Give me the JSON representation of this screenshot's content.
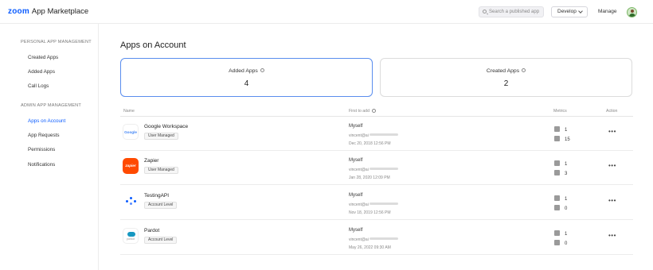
{
  "header": {
    "brand": "zoom",
    "app_name": "App Marketplace",
    "search_placeholder": "Search a published app",
    "develop_label": "Develop",
    "manage_label": "Manage",
    "icons": [
      "search-icon",
      "chevron-down-icon",
      "avatar"
    ]
  },
  "sidebar": {
    "personal_heading": "PERSONAL APP MANAGEMENT",
    "personal_items": [
      {
        "label": "Created Apps"
      },
      {
        "label": "Added Apps"
      },
      {
        "label": "Call Logs"
      }
    ],
    "admin_heading": "ADMIN APP MANAGEMENT",
    "admin_items": [
      {
        "label": "Apps on Account",
        "active": true
      },
      {
        "label": "App Requests"
      },
      {
        "label": "Permissions"
      },
      {
        "label": "Notifications"
      }
    ],
    "active_color": "#0b5cff"
  },
  "main": {
    "title": "Apps on Account",
    "cards": [
      {
        "label": "Added Apps",
        "value": "4",
        "selected": true
      },
      {
        "label": "Created Apps",
        "value": "2",
        "selected": false
      }
    ],
    "table": {
      "headers": {
        "name": "Name",
        "first_to_add": "First to add",
        "metrics": "Metrics",
        "action": "Action"
      },
      "rows": [
        {
          "logo_text": "Google",
          "name": "Google Workspace",
          "tag": "User Managed",
          "who": "Myself",
          "email": "vincent@ai",
          "date": "Dec 20, 2018 12:56 PM",
          "metric1": "1",
          "metric2": "15",
          "action": "•••"
        },
        {
          "logo_text": "zapier",
          "name": "Zapier",
          "tag": "User Managed",
          "who": "Myself",
          "email": "vincent@ai",
          "date": "Jan 28, 2020 12:09 PM",
          "metric1": "1",
          "metric2": "3",
          "action": "•••"
        },
        {
          "logo_text": "",
          "name": "TestingAPI",
          "tag": "Account Level",
          "who": "Myself",
          "email": "vincent@ai",
          "date": "Nov 18, 2019 12:56 PM",
          "metric1": "1",
          "metric2": "0",
          "action": "•••"
        },
        {
          "logo_text": "pardot",
          "name": "Pardot",
          "tag": "Account Level",
          "who": "Myself",
          "email": "vincent@ai",
          "date": "May 26, 2022 09:30 AM",
          "metric1": "1",
          "metric2": "0",
          "action": "•••"
        }
      ]
    }
  }
}
